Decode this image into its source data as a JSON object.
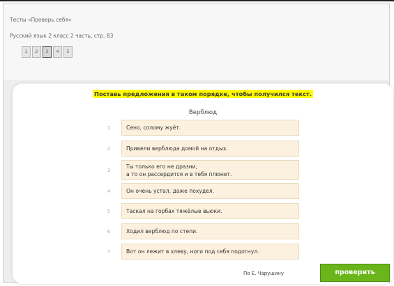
{
  "header": {
    "title": "Тесты «Проверь себя»",
    "subtitle": "Русский язык 2 класс 2 часть, стр. 83",
    "pages": [
      "1",
      "2",
      "3",
      "4",
      "5"
    ],
    "active_page": "3"
  },
  "task": {
    "instruction": "Поставь предложения в таком порядке, чтобы получился текст.",
    "story_title": "Верблюд",
    "items": [
      {
        "num": "1",
        "text": "Сено, солому жуёт."
      },
      {
        "num": "2",
        "text": "Привели верблюда домой на отдых."
      },
      {
        "num": "3",
        "line1": "Ты только его не дразни,",
        "line2": "а то он рассердится и в тебя плюнет."
      },
      {
        "num": "4",
        "text": "Он очень устал, даже похудел."
      },
      {
        "num": "5",
        "text": "Таскал на горбах тяжёлые вьюки."
      },
      {
        "num": "6",
        "text": "Ходил верблюд по степи."
      },
      {
        "num": "7",
        "text": "Вот он лежит в хлеву, ноги под себя подогнул."
      }
    ],
    "author": "По Е. Чарушину",
    "check_label": "проверить"
  },
  "colors": {
    "highlight": "#fffa00",
    "item_bg": "#fbf1de",
    "button": "#69b51a"
  }
}
